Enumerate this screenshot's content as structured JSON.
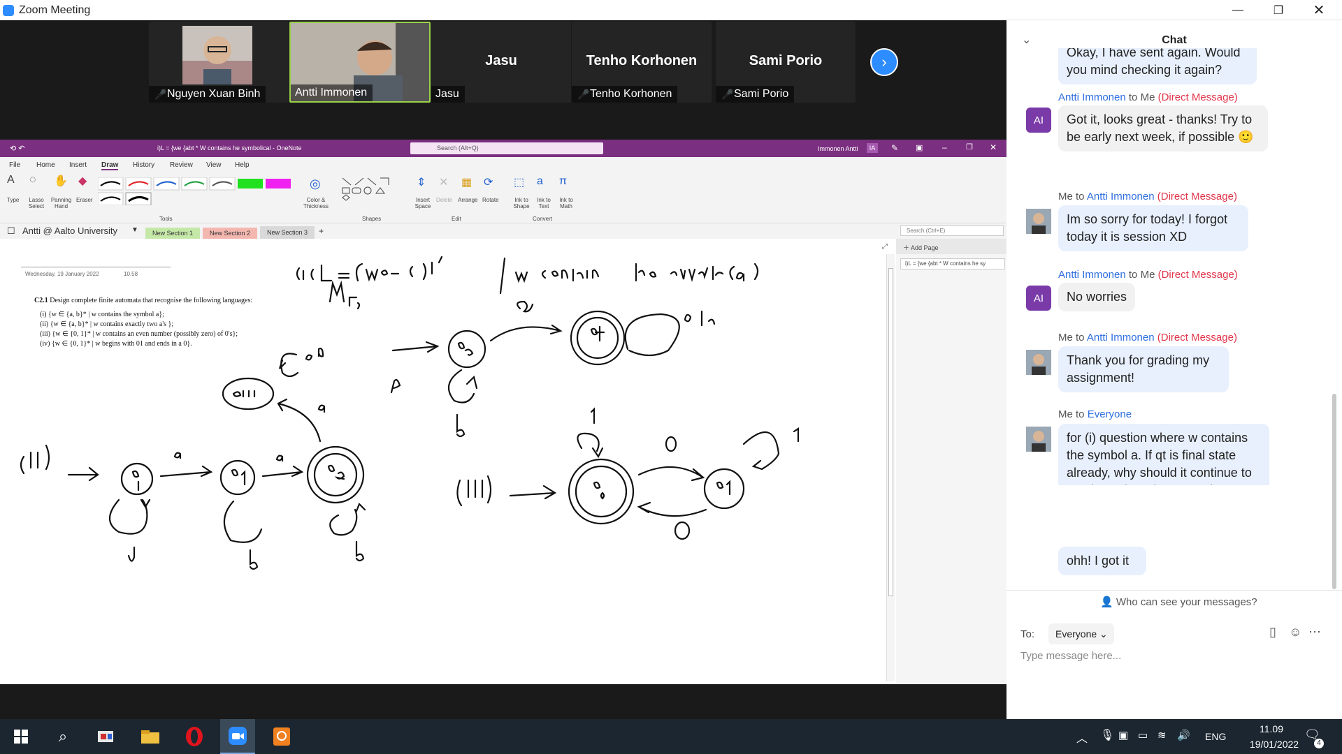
{
  "window": {
    "title": "Zoom Meeting"
  },
  "gallery": {
    "participants": [
      {
        "name": "Nguyen Xuan Binh",
        "muted": true,
        "video": true
      },
      {
        "name": "Antti Immonen",
        "muted": false,
        "video": true,
        "active": true
      },
      {
        "name": "Jasu",
        "display": "Jasu",
        "muted": false,
        "video": false
      },
      {
        "name": "Tenho Korhonen",
        "display": "Tenho Korhonen",
        "muted": true,
        "video": false
      },
      {
        "name": "Sami Porio",
        "display": "Sami Porio",
        "muted": true,
        "video": false
      }
    ]
  },
  "onenote": {
    "title": "i)L = {we {abt * W contains he symbolical - OneNote",
    "search_placeholder": "Search (Alt+Q)",
    "user": "Immonen Antti",
    "user_initials": "IA",
    "tabs": [
      "File",
      "Home",
      "Insert",
      "Draw",
      "History",
      "Review",
      "View",
      "Help"
    ],
    "active_tab": "Draw",
    "ribbon": {
      "tools": [
        "Type",
        "Lasso Select",
        "Panning Hand",
        "Eraser"
      ],
      "color_thickness": "Color & Thickness",
      "insert_space": "Insert Space",
      "delete": "Delete",
      "arrange": "Arrange",
      "rotate": "Rotate",
      "ink_shape": "Ink to Shape",
      "ink_text": "Ink to Text",
      "ink_math": "Ink to Math",
      "groups": {
        "tools": "Tools",
        "shapes": "Shapes",
        "edit": "Edit",
        "convert": "Convert"
      }
    },
    "notebook": "Antti @ Aalto University",
    "sections": [
      "New Section 1",
      "New Section 2",
      "New Section 3"
    ],
    "section_colors": [
      "#c5e8a8",
      "#f4b7b0",
      "#d9d9d9"
    ],
    "search_page": "Search (Ctrl+E)",
    "add_page": "Add Page",
    "page_list_item": "i)L = {we {abt * W contains he sy",
    "page": {
      "date": "Wednesday, 19 January 2022",
      "time": "10.58",
      "problem_title": "C2.1",
      "problem_text": "Design complete finite automata that recognise the following languages:",
      "items": [
        "(i) {w ∈ {a, b}* | w contains the symbol a};",
        "(ii) {w ∈ {a, b}* | w contains exactly two a's };",
        "(iii) {w ∈ {0, 1}* | w contains an even number (possibly zero) of 0's};",
        "(iv) {w ∈ {0, 1}* | w begins with 01 and ends in a 0}."
      ]
    }
  },
  "chat": {
    "title": "Chat",
    "messages": [
      {
        "type": "bubble",
        "text": "you mind checking it again?",
        "partial_text": "Okay, I have sent again. Would",
        "style": "blue"
      },
      {
        "from": "Antti Immonen",
        "to": "Me",
        "dm": "(Direct Message)",
        "initials": "AI",
        "texts": [
          "Got it, looks great - thanks! Try to be early next week, if possible 🙂"
        ],
        "style": "grey"
      },
      {
        "from": "Me",
        "to": "Antti Immonen",
        "dm": "(Direct Message)",
        "texts": [
          "Im so sorry for today! I forgot today it is session XD"
        ],
        "style": "blue"
      },
      {
        "from": "Antti Immonen",
        "to": "Me",
        "dm": "(Direct Message)",
        "initials": "AI",
        "texts": [
          "No worries"
        ],
        "style": "grey"
      },
      {
        "from": "Me",
        "to": "Antti Immonen",
        "dm": "(Direct Message)",
        "texts": [
          "Thank you for grading my assignment!"
        ],
        "style": "blue"
      },
      {
        "from": "Me",
        "to": "Everyone",
        "texts": [
          "for (i) question where w contains the symbol a. If qt is final state already, why should it continue to receive a, b and return to its state?",
          "ohh! I got it"
        ],
        "style": "blue"
      }
    ],
    "to_word": "to",
    "who_can_see": "Who can see your messages?",
    "to_label": "To:",
    "recipient": "Everyone",
    "input_placeholder": "Type message here..."
  },
  "taskbar": {
    "lang": "ENG",
    "time": "11.09",
    "date": "19/01/2022",
    "notif_count": "4"
  }
}
